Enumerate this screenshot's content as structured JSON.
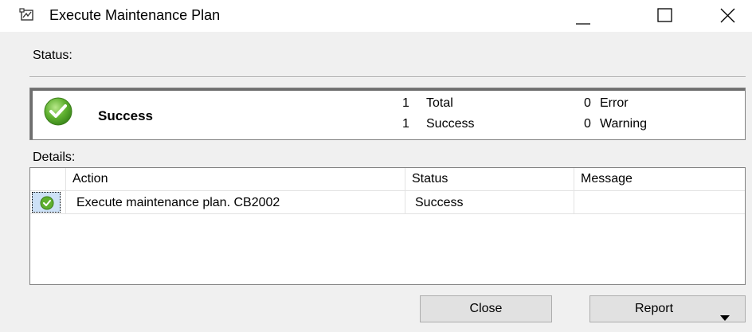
{
  "window": {
    "title": "Execute Maintenance Plan"
  },
  "status": {
    "label": "Status:",
    "result": "Success",
    "total_count": "1",
    "total_label": "Total",
    "success_count": "1",
    "success_label": "Success",
    "error_count": "0",
    "error_label": "Error",
    "warning_count": "0",
    "warning_label": "Warning"
  },
  "details": {
    "label": "Details:",
    "columns": {
      "action": "Action",
      "status": "Status",
      "message": "Message"
    },
    "rows": [
      {
        "action": "Execute maintenance plan. CB2002",
        "status": "Success",
        "message": ""
      }
    ]
  },
  "buttons": {
    "close": "Close",
    "report": "Report"
  },
  "icons": {
    "app": "maintenance-plan-icon",
    "status": "success-check-icon",
    "row": "success-check-icon",
    "report_menu": "dropdown-arrow-icon"
  },
  "colors": {
    "success_green": "#5fb030",
    "window_bg": "#f0f0f0",
    "button_bg": "#e1e1e1",
    "row_focus": "#cde1f7"
  }
}
